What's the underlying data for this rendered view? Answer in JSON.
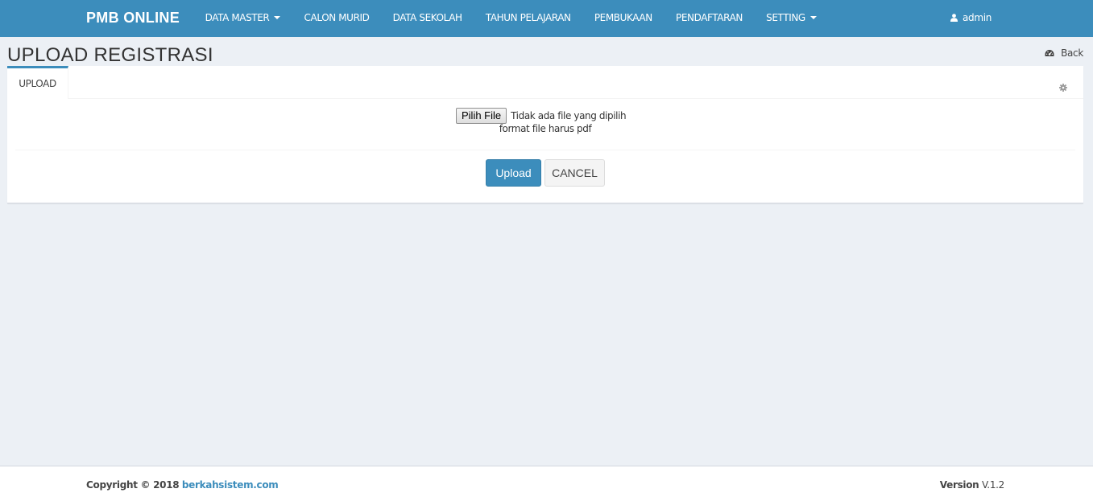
{
  "navbar": {
    "brand": "PMB ONLINE",
    "items": [
      {
        "label": "DATA MASTER",
        "dropdown": true
      },
      {
        "label": "CALON MURID",
        "dropdown": false
      },
      {
        "label": "DATA SEKOLAH",
        "dropdown": false
      },
      {
        "label": "TAHUN PELAJARAN",
        "dropdown": false
      },
      {
        "label": "PEMBUKAAN",
        "dropdown": false
      },
      {
        "label": "PENDAFTARAN",
        "dropdown": false
      },
      {
        "label": "SETTING",
        "dropdown": true
      }
    ],
    "user": {
      "name": "admin",
      "icon": "user-icon"
    }
  },
  "header": {
    "title": "UPLOAD REGISTRASI",
    "back": {
      "label": "Back",
      "icon": "dashboard-icon"
    }
  },
  "box": {
    "tab": "UPLOAD",
    "settings_icon": "gear-icon",
    "file_input": {
      "button_label": "Pilih File",
      "status_text": "Tidak ada file yang dipilih"
    },
    "hint": "format file harus pdf",
    "upload_label": "Upload",
    "cancel_label": "CANCEL"
  },
  "footer": {
    "copyright_prefix": "Copyright © 2018",
    "copyright_link": "berkahsistem.com",
    "version_label": "Version",
    "version_value": "V.1.2"
  },
  "colors": {
    "primary": "#3c8dbc",
    "background": "#ecf0f5"
  }
}
